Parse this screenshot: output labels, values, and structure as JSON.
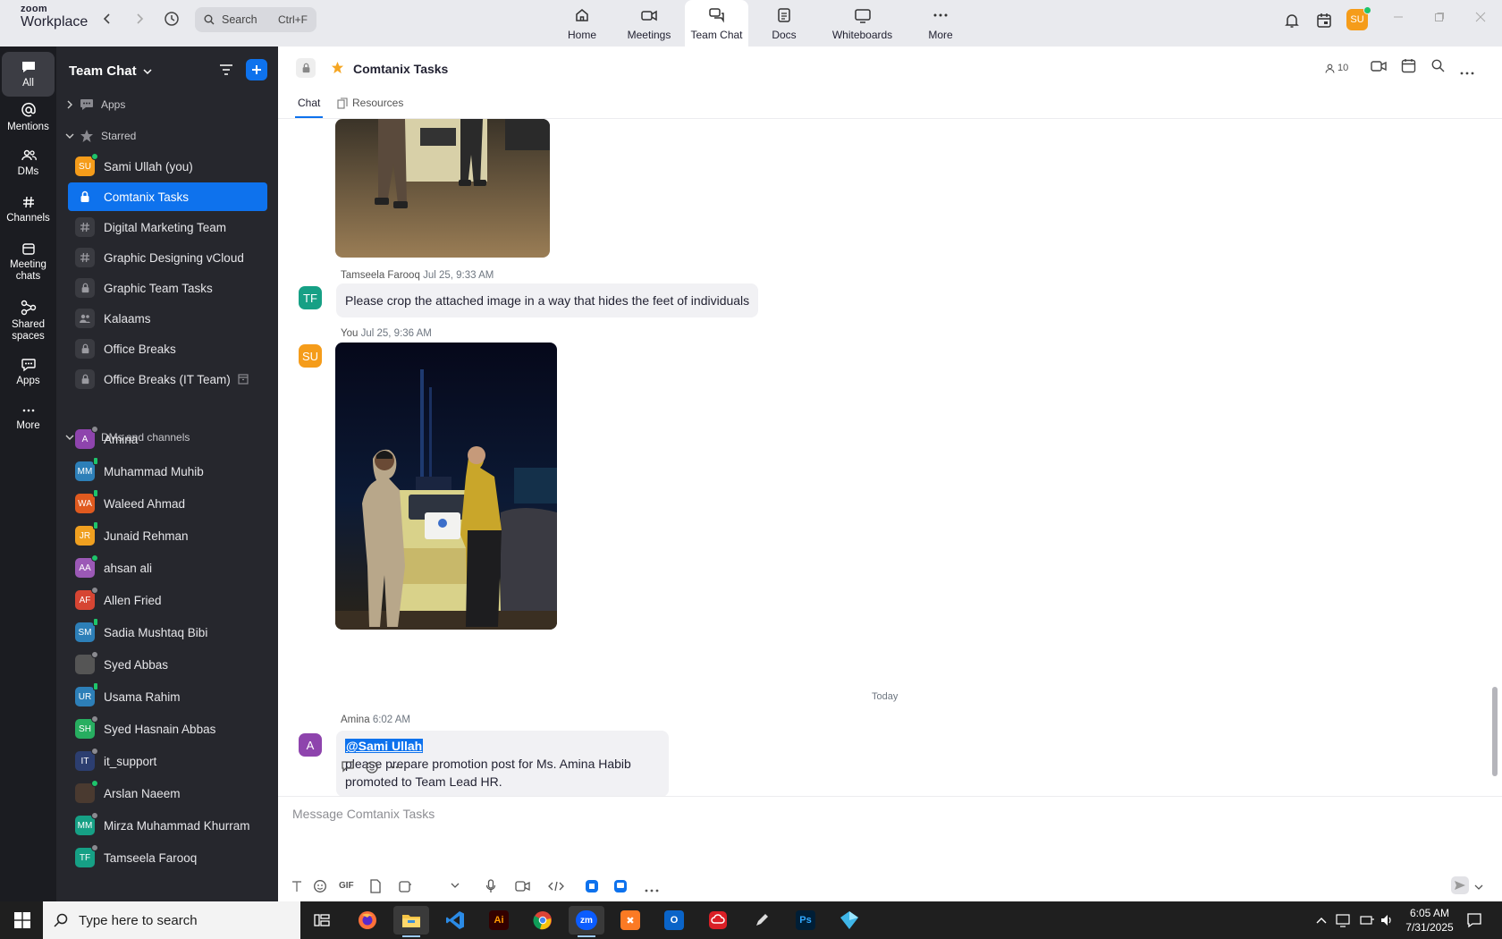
{
  "app": {
    "brand_top": "zoom",
    "brand_bottom": "Workplace"
  },
  "search": {
    "placeholder": "Search",
    "shortcut": "Ctrl+F"
  },
  "tabs": [
    {
      "label": "Home",
      "icon": "home-icon"
    },
    {
      "label": "Meetings",
      "icon": "video-icon"
    },
    {
      "label": "Team Chat",
      "icon": "chat-icon"
    },
    {
      "label": "Docs",
      "icon": "doc-icon"
    },
    {
      "label": "Whiteboards",
      "icon": "whiteboard-icon"
    },
    {
      "label": "More",
      "icon": "more-icon"
    }
  ],
  "user": {
    "initials": "SU",
    "color": "#f59c1a"
  },
  "rail": [
    {
      "label": "All",
      "icon": "chat-bubble-icon"
    },
    {
      "label": "Mentions",
      "icon": "at-icon"
    },
    {
      "label": "DMs",
      "icon": "people-icon"
    },
    {
      "label": "Channels",
      "icon": "hash-icon"
    },
    {
      "label": "Meeting chats",
      "icon": "calendar-icon"
    },
    {
      "label": "Shared spaces",
      "icon": "share-icon"
    },
    {
      "label": "Apps",
      "icon": "apps-icon"
    },
    {
      "label": "More",
      "icon": "more-icon"
    }
  ],
  "sidebar": {
    "title": "Team Chat",
    "sections": {
      "apps": "Apps",
      "starred": "Starred",
      "dms": "DMs and channels"
    },
    "starred": [
      {
        "label": "Sami Ullah (you)",
        "type": "avatar",
        "initials": "SU",
        "color": "#f59c1a",
        "status": "on"
      },
      {
        "label": "Comtanix Tasks",
        "type": "lock"
      },
      {
        "label": "Digital Marketing Team",
        "type": "hash"
      },
      {
        "label": "Graphic Designing vCloud",
        "type": "hash"
      },
      {
        "label": "Graphic Team Tasks",
        "type": "lock"
      },
      {
        "label": "Kalaams",
        "type": "group"
      },
      {
        "label": "Office Breaks",
        "type": "lock"
      },
      {
        "label": "Office Breaks (IT Team)",
        "type": "lock"
      }
    ],
    "dms": [
      {
        "label": "Amina",
        "initials": "A",
        "color": "#8e44ad",
        "status": "off"
      },
      {
        "label": "Muhammad Muhib",
        "initials": "MM",
        "color": "#2d7fb8",
        "status": "ph"
      },
      {
        "label": "Waleed Ahmad",
        "initials": "WA",
        "color": "#e05a1f",
        "status": "ph"
      },
      {
        "label": "Junaid Rehman",
        "initials": "JR",
        "color": "#f0a020",
        "status": "ph"
      },
      {
        "label": "ahsan ali",
        "initials": "AA",
        "color": "#9b59b6",
        "status": "on"
      },
      {
        "label": "Allen Fried",
        "initials": "AF",
        "color": "#d64533",
        "status": "off"
      },
      {
        "label": "Sadia Mushtaq Bibi",
        "initials": "SM",
        "color": "#2d7fb8",
        "status": "ph"
      },
      {
        "label": "Syed Abbas",
        "initials": "",
        "color": "#555555",
        "status": "off"
      },
      {
        "label": "Usama Rahim",
        "initials": "UR",
        "color": "#2d7fb8",
        "status": "ph"
      },
      {
        "label": "Syed Hasnain Abbas",
        "initials": "SH",
        "color": "#27ae60",
        "status": "off"
      },
      {
        "label": "it_support",
        "initials": "IT",
        "color": "#2c3e70",
        "status": "off"
      },
      {
        "label": "Arslan Naeem",
        "initials": "",
        "color": "#4a3a30",
        "status": "on"
      },
      {
        "label": "Mirza Muhammad Khurram",
        "initials": "MM",
        "color": "#16a085",
        "status": "off"
      },
      {
        "label": "Tamseela Farooq",
        "initials": "TF",
        "color": "#16a085",
        "status": "off"
      }
    ]
  },
  "channel": {
    "name": "Comtanix Tasks",
    "members": "10",
    "tabs": {
      "chat": "Chat",
      "resources": "Resources"
    }
  },
  "messages": [
    {
      "sender": "Tamseela Farooq",
      "time": "Jul 25, 9:33 AM",
      "initials": "TF",
      "color": "#16a085",
      "text": "Please crop the attached image in a way that hides the feet of individuals"
    },
    {
      "sender": "You",
      "time": "Jul 25, 9:36 AM",
      "initials": "SU",
      "color": "#f59c1a"
    },
    {
      "sender": "Amina",
      "time": "6:02 AM",
      "initials": "A",
      "color": "#8e44ad",
      "mention": "@Sami Ullah",
      "line1": "please prepare promotion post for Ms. Amina Habib",
      "line2": "promoted to Team Lead HR."
    }
  ],
  "day_separator": "Today",
  "composer": {
    "placeholder": "Message Comtanix Tasks",
    "gif": "GIF"
  },
  "taskbar": {
    "search_placeholder": "Type here to search",
    "time": "6:05 AM",
    "date": "7/31/2025",
    "apps": [
      "task-view",
      "firefox",
      "file-explorer",
      "vscode",
      "illustrator",
      "chrome",
      "zoom",
      "xampp",
      "outlook",
      "creative-cloud",
      "pen-tool",
      "photoshop",
      "app"
    ]
  }
}
